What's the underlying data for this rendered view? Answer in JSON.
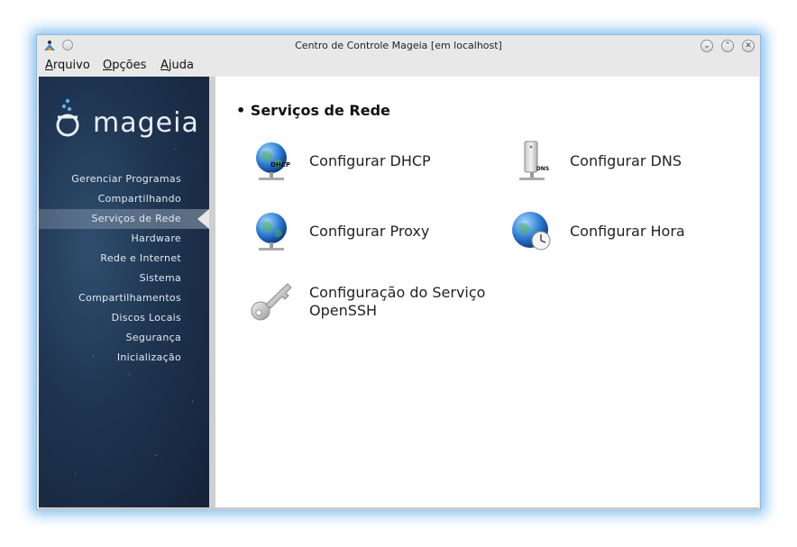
{
  "window": {
    "title": "Centro de Controle Mageia  [em localhost]",
    "controls": {
      "minimize_icon": "chevron-down-icon",
      "maximize_icon": "chevron-up-icon",
      "close_icon": "close-icon"
    }
  },
  "menubar": {
    "items": [
      {
        "label": "rquivo",
        "mnemonic": "A"
      },
      {
        "label": "pções",
        "mnemonic": "O"
      },
      {
        "label": "juda",
        "mnemonic": "A"
      }
    ]
  },
  "sidebar": {
    "logo_text": "mageia",
    "items": [
      {
        "label": "Gerenciar Programas",
        "active": false
      },
      {
        "label": "Compartilhando",
        "active": false
      },
      {
        "label": "Serviços de Rede",
        "active": true
      },
      {
        "label": "Hardware",
        "active": false
      },
      {
        "label": "Rede e Internet",
        "active": false
      },
      {
        "label": "Sistema",
        "active": false
      },
      {
        "label": "Compartilhamentos",
        "active": false
      },
      {
        "label": "Discos Locais",
        "active": false
      },
      {
        "label": "Segurança",
        "active": false
      },
      {
        "label": "Inicialização",
        "active": false
      }
    ]
  },
  "main": {
    "section_title": "Serviços de Rede",
    "tools": [
      {
        "label": "Configurar DHCP",
        "icon": "dhcp-globe-icon",
        "icon_badge": "DHCP"
      },
      {
        "label": "Configurar DNS",
        "icon": "dns-server-icon",
        "icon_badge": "DNS"
      },
      {
        "label": "Configurar Proxy",
        "icon": "proxy-globe-icon"
      },
      {
        "label": "Configurar Hora",
        "icon": "time-globe-icon"
      },
      {
        "label_line1": "Configuração do Serviço",
        "label_line2": "OpenSSH",
        "icon": "ssh-key-icon"
      }
    ]
  },
  "colors": {
    "sidebar_bg": "#1e3450",
    "glow": "#5aaaeb",
    "accent_blue": "#2f7fd6"
  }
}
